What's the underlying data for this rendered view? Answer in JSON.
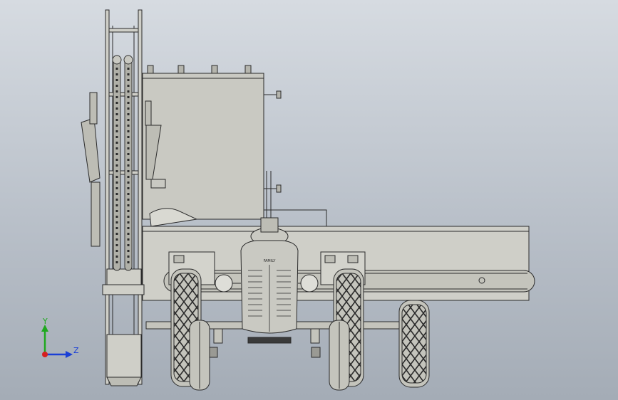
{
  "viewport": {
    "background_top": "#d6dbe1",
    "background_bottom": "#a4acb6"
  },
  "model": {
    "badge_text": "FAMILY",
    "line_color": "#2b2b2b",
    "body_fill": "#c9c9c2",
    "dark_fill": "#3a3a3a"
  },
  "triad": {
    "y_label": "Y",
    "z_label": "Z",
    "y_color": "#1fa81f",
    "z_color": "#1a3fd6",
    "x_color": "#d62020"
  }
}
